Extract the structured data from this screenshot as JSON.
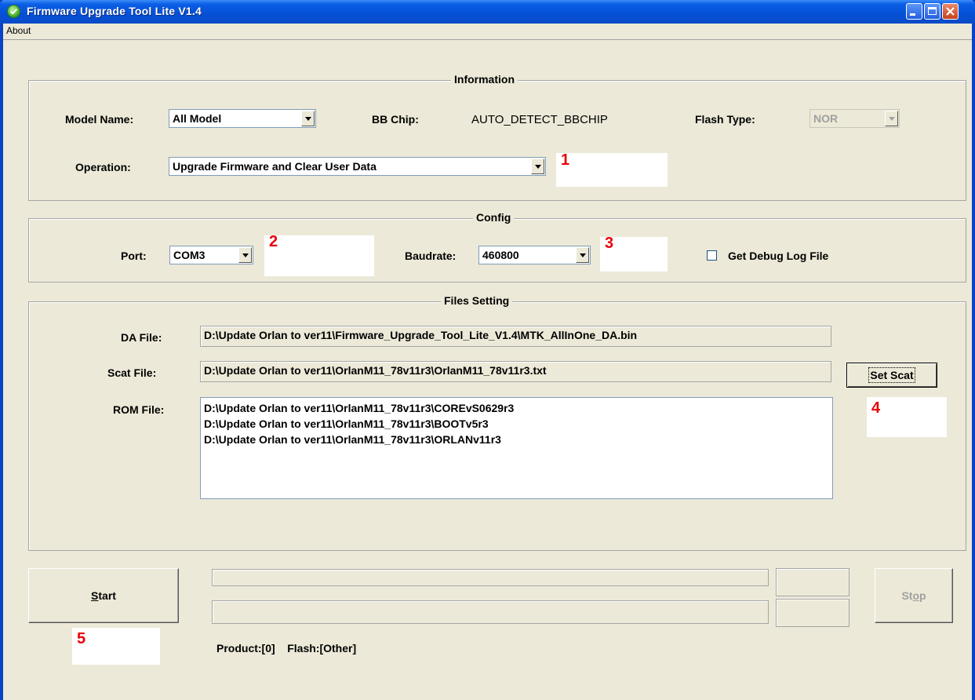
{
  "window": {
    "title": "Firmware Upgrade Tool Lite V1.4",
    "accent_color": "#0a5ee5",
    "annotation_color": "#e8000a"
  },
  "menu": {
    "about": "About"
  },
  "information": {
    "title": "Information",
    "model_label": "Model Name:",
    "model_value": "All Model",
    "bbchip_label": "BB Chip:",
    "bbchip_value": "AUTO_DETECT_BBCHIP",
    "flash_type_label": "Flash Type:",
    "flash_type_value": "NOR",
    "operation_label": "Operation:",
    "operation_value": "Upgrade Firmware and Clear User Data",
    "note": "1"
  },
  "config": {
    "title": "Config",
    "port_label": "Port:",
    "port_value": "COM3",
    "port_note": "2",
    "baud_label": "Baudrate:",
    "baud_value": "460800",
    "baud_note": "3",
    "debug_label": "Get Debug Log File",
    "debug_checked": false
  },
  "files": {
    "title": "Files Setting",
    "da_label": "DA File:",
    "da_value": "D:\\Update Orlan to ver11\\Firmware_Upgrade_Tool_Lite_V1.4\\MTK_AllInOne_DA.bin",
    "scat_label": "Scat File:",
    "scat_value": "D:\\Update Orlan to ver11\\OrlanM11_78v11r3\\OrlanM11_78v11r3.txt",
    "set_scat_label": "Set Scat",
    "set_scat_note": "4",
    "rom_label": "ROM File:",
    "rom_items": [
      "D:\\Update Orlan to ver11\\OrlanM11_78v11r3\\COREvS0629r3",
      "D:\\Update Orlan to ver11\\OrlanM11_78v11r3\\BOOTv5r3",
      "D:\\Update Orlan to ver11\\OrlanM11_78v11r3\\ORLANv11r3"
    ]
  },
  "bottom": {
    "start_mnemonic": "S",
    "start_rest": "tart",
    "start_note": "5",
    "stop_pre": "St",
    "stop_mnemonic": "o",
    "stop_post": "p",
    "progress1": 0,
    "progress2": 0,
    "status": "Product:[0]    Flash:[Other]"
  }
}
